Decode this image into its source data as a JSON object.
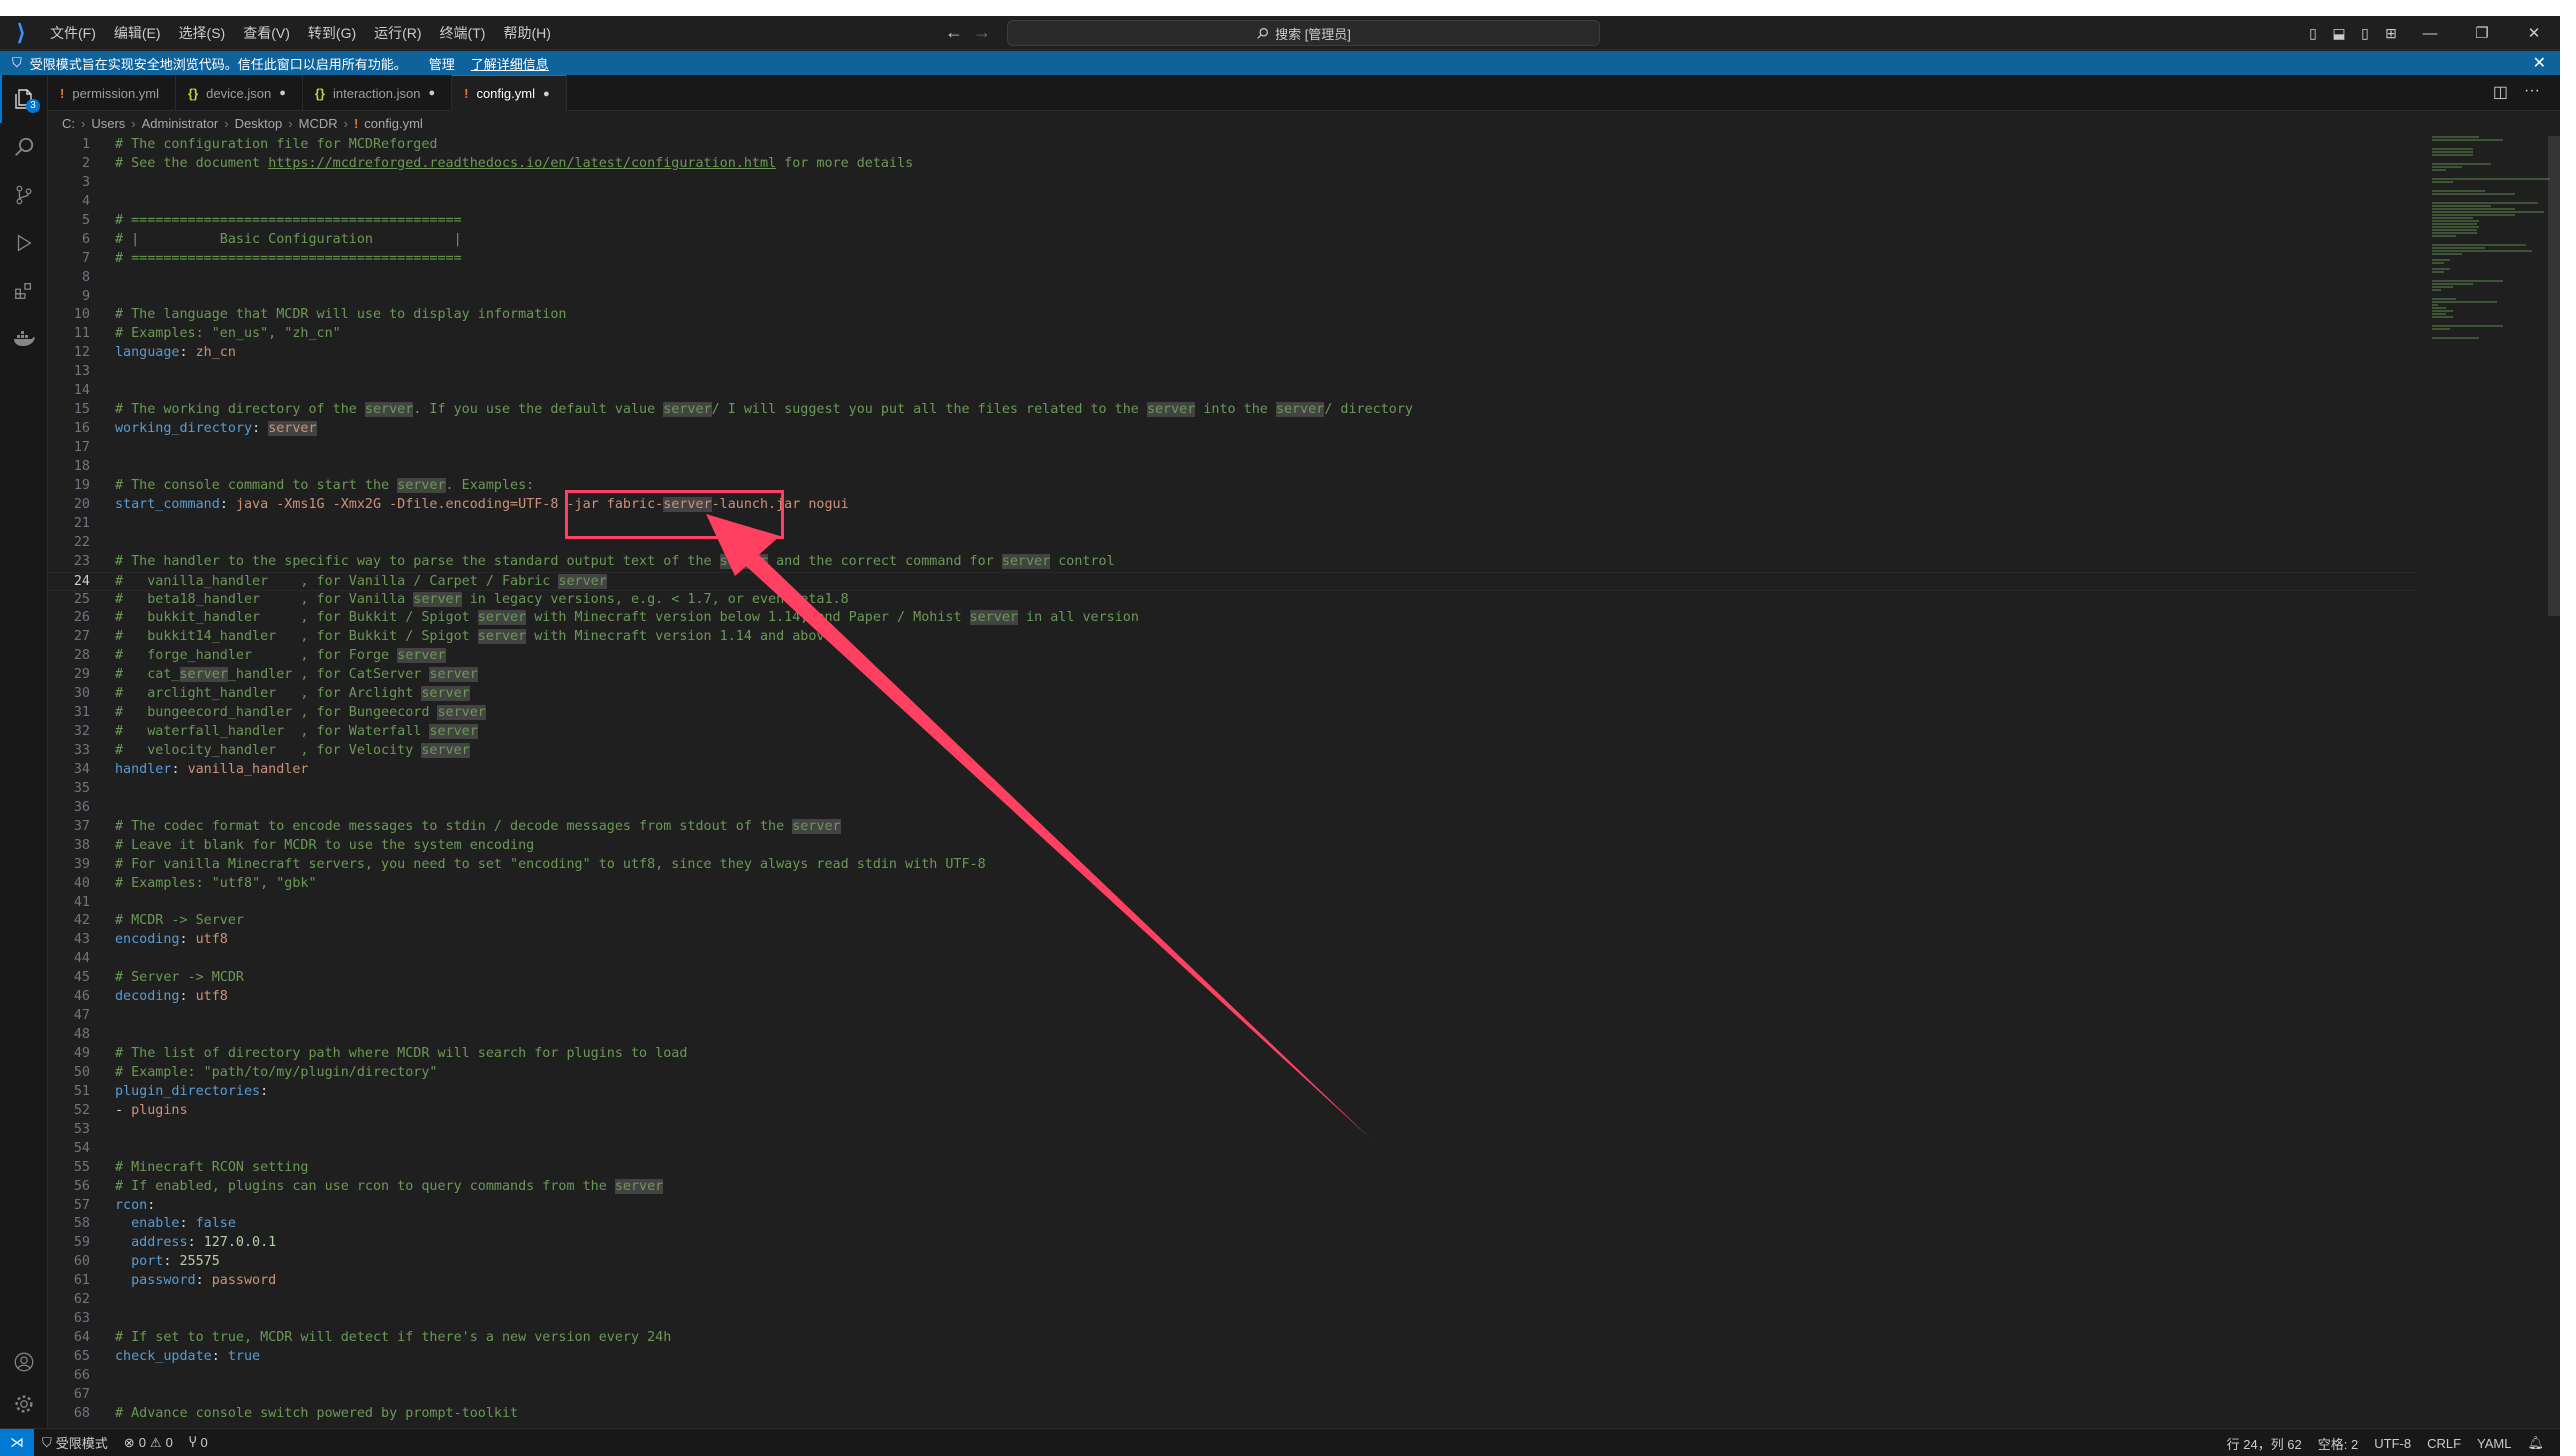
{
  "titlebar": {
    "menu": [
      "文件(F)",
      "编辑(E)",
      "选择(S)",
      "查看(V)",
      "转到(G)",
      "运行(R)",
      "终端(T)",
      "帮助(H)"
    ],
    "search_placeholder": "搜索 [管理员]",
    "icons": [
      "toggle-primary-sidebar-icon",
      "toggle-panel-icon",
      "toggle-secondary-sidebar-icon",
      "customize-layout-icon",
      "minimize-icon",
      "restore-icon",
      "close-icon"
    ]
  },
  "banner": {
    "text": "受限模式旨在实现安全地浏览代码。信任此窗口以启用所有功能。",
    "manage": "管理",
    "learn_more": "了解详细信息"
  },
  "activity": {
    "explorer_badge": "3"
  },
  "tabs": [
    {
      "label": "permission.yml",
      "icon": "!",
      "modified": false
    },
    {
      "label": "device.json",
      "icon": "{}",
      "modified": true
    },
    {
      "label": "interaction.json",
      "icon": "{}",
      "modified": true
    },
    {
      "label": "config.yml",
      "icon": "!",
      "modified": true,
      "active": true
    }
  ],
  "breadcrumb": [
    "C:",
    "Users",
    "Administrator",
    "Desktop",
    "MCDR",
    "config.yml"
  ],
  "cursor_line": 24,
  "code": {
    "l1": "# The configuration file for MCDReforged",
    "l2a": "# See the document ",
    "l2u": "https://mcdreforged.readthedocs.io/en/latest/configuration.html",
    "l2b": " for more details",
    "l5": "# =========================================",
    "l6": "# |          Basic Configuration          |",
    "l7": "# =========================================",
    "l10": "# The language that MCDR will use to display information",
    "l11": "# Examples: \"en_us\", \"zh_cn\"",
    "k_language": "language",
    "v_language": "zh_cn",
    "l15": "# The working directory of the server. If you use the default value server/ I will suggest you put all the files related to the server into the server/ directory",
    "k_workdir": "working_directory",
    "v_workdir": "server",
    "l19": "# The console command to start the server. Examples:",
    "k_start": "start_command",
    "v_start": "java -Xms1G -Xmx2G -Dfile.encoding=UTF-8 -jar fabric-server-launch.jar nogui",
    "l23": "# The handler to the specific way to parse the standard output text of the server and the correct command for server control",
    "l24": "#   vanilla_handler    , for Vanilla / Carpet / Fabric server",
    "l25": "#   beta18_handler     , for Vanilla server in legacy versions, e.g. < 1.7, or even beta1.8",
    "l26": "#   bukkit_handler     , for Bukkit / Spigot server with Minecraft version below 1.14, and Paper / Mohist server in all version",
    "l27": "#   bukkit14_handler   , for Bukkit / Spigot server with Minecraft version 1.14 and above",
    "l28": "#   forge_handler      , for Forge server",
    "l29": "#   cat_server_handler , for CatServer server",
    "l30": "#   arclight_handler   , for Arclight server",
    "l31": "#   bungeecord_handler , for Bungeecord server",
    "l32": "#   waterfall_handler  , for Waterfall server",
    "l33": "#   velocity_handler   , for Velocity server",
    "k_handler": "handler",
    "v_handler": "vanilla_handler",
    "l37": "# The codec format to encode messages to stdin / decode messages from stdout of the server",
    "l38": "# Leave it blank for MCDR to use the system encoding",
    "l39": "# For vanilla Minecraft servers, you need to set \"encoding\" to utf8, since they always read stdin with UTF-8",
    "l40": "# Examples: \"utf8\", \"gbk\"",
    "l42": "# MCDR -> Server",
    "k_encoding": "encoding",
    "v_encoding": "utf8",
    "l45": "# Server -> MCDR",
    "k_decoding": "decoding",
    "v_decoding": "utf8",
    "l49": "# The list of directory path where MCDR will search for plugins to load",
    "l50": "# Example: \"path/to/my/plugin/directory\"",
    "k_plugin_dirs": "plugin_directories",
    "v_plugins": "plugins",
    "l55": "# Minecraft RCON setting",
    "l56": "# If enabled, plugins can use rcon to query commands from the server",
    "k_rcon": "rcon",
    "k_enable": "enable",
    "v_enable": "false",
    "k_address": "address",
    "v_address": "127.0.0.1",
    "k_port": "port",
    "v_port": "25575",
    "k_password": "password",
    "v_password": "password",
    "l64": "# If set to true, MCDR will detect if there's a new version every 24h",
    "k_check": "check_update",
    "v_check": "true",
    "l68": "# Advance console switch powered by prompt-toolkit"
  },
  "statusbar": {
    "restricted": "受限模式",
    "errors": "0",
    "warnings": "0",
    "ports": "0",
    "position": "行 24，列 62",
    "spaces": "空格: 2",
    "encoding": "UTF-8",
    "eol": "CRLF",
    "language": "YAML"
  },
  "colors": {
    "accent": "#0078d4",
    "banner": "#0e639c",
    "annotation": "#ff4060",
    "comment": "#6a9955",
    "key": "#569cd6",
    "value": "#ce9178"
  }
}
